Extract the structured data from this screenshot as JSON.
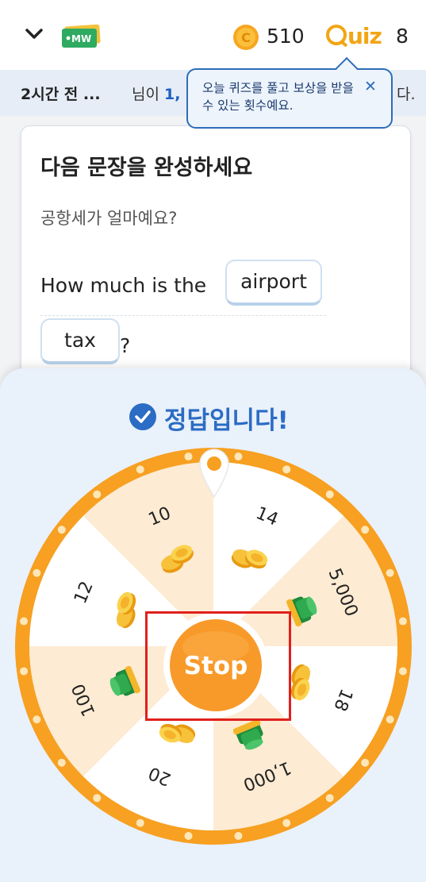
{
  "header": {
    "back_icon": "chevron-down-icon",
    "logo_text": "MW",
    "coin_icon": "coin-icon",
    "coin_count": "510",
    "quiz_logo_letter": "Q",
    "quiz_logo_rest": "uiz",
    "quiz_count": "8"
  },
  "ticker": {
    "time": "2시간 전 ...",
    "message_prefix": "님이",
    "message_highlight": "1,",
    "message_end": "다."
  },
  "tooltip": {
    "text": "오늘 퀴즈를 풀고 보상을 받을 수 있는 횟수예요.",
    "close_icon": "close-icon"
  },
  "quiz": {
    "title": "다음 문장을 완성하세요",
    "korean": "공항세가 얼마예요?",
    "sentence_start": "How much is the",
    "answer_word_1": "airport",
    "answer_word_2": "tax",
    "sentence_end": "?"
  },
  "result": {
    "check_icon": "check-circle-icon",
    "text": "정답입니다!"
  },
  "wheel": {
    "pointer_icon": "location-pin-icon",
    "segments": [
      {
        "label": "14",
        "icon": "gold-coins-icon"
      },
      {
        "label": "5,000",
        "icon": "green-bills-icon"
      },
      {
        "label": "18",
        "icon": "gold-coins-icon"
      },
      {
        "label": "1,000",
        "icon": "green-bills-icon"
      },
      {
        "label": "20",
        "icon": "gold-coins-icon"
      },
      {
        "label": "100",
        "icon": "green-bills-icon"
      },
      {
        "label": "12",
        "icon": "gold-coins-icon"
      },
      {
        "label": "10",
        "icon": "gold-coins-icon"
      }
    ],
    "stop_label": "Stop"
  },
  "colors": {
    "accent_orange": "#f7a021",
    "stop_orange": "#f89a2a",
    "blue": "#2b6cc4",
    "highlight_red": "#e0201d",
    "segment_alt": "#fdebd3"
  }
}
